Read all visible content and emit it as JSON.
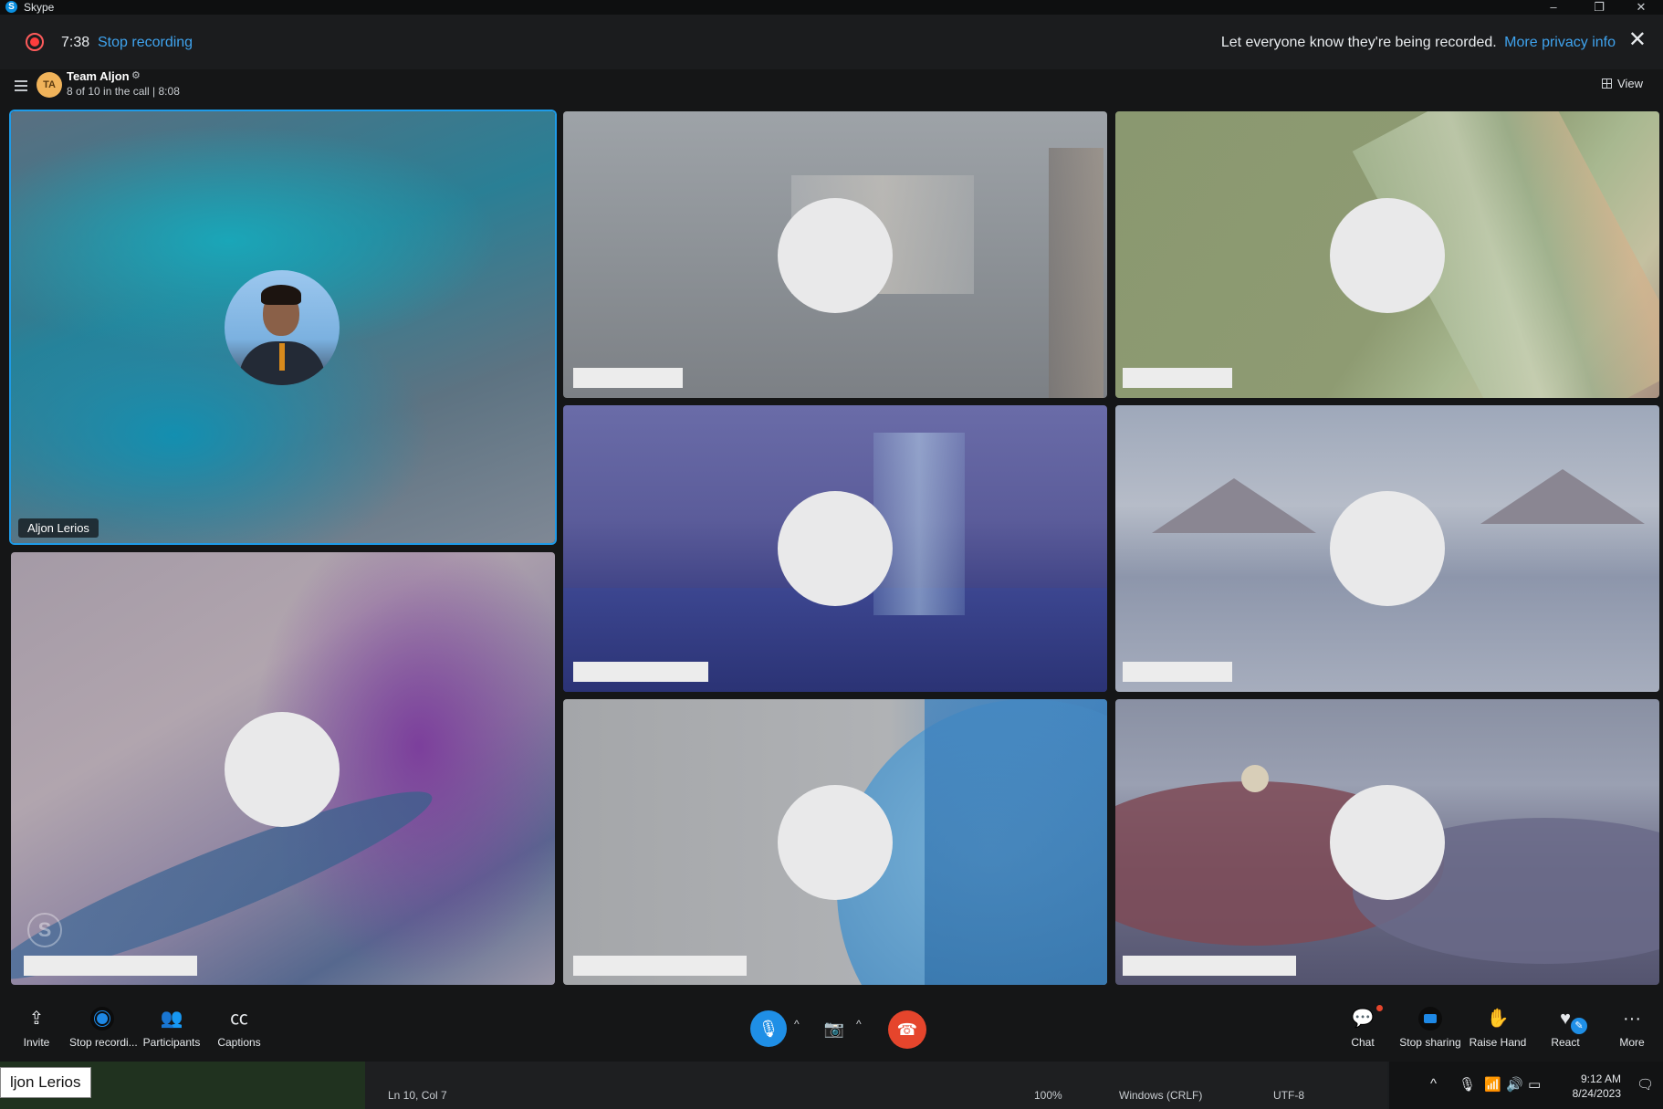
{
  "window": {
    "app_title": "Skype",
    "minimize": "–",
    "maximize": "❐",
    "close": "✕"
  },
  "recording": {
    "time": "7:38",
    "stop_label": "Stop recording",
    "notice": "Let everyone know they're being recorded.",
    "privacy_link": "More privacy info",
    "close": "✕"
  },
  "call": {
    "avatar_initials": "TA",
    "team_name": "Team Aljon",
    "settings_icon": "⚙",
    "participants_info": "8 of 10 in the call | 8:08",
    "view_label": "View"
  },
  "tiles": {
    "active_name": "Aljon Lerios",
    "watermark": "S"
  },
  "toolbar": {
    "invite": "Invite",
    "stop_recording": "Stop recordi...",
    "participants": "Participants",
    "captions": "Captions",
    "chat": "Chat",
    "stop_sharing": "Stop sharing",
    "raise_hand": "Raise Hand",
    "react": "React",
    "more": "More",
    "icons": {
      "invite": "⇪",
      "participants": "👥",
      "captions": "㏄",
      "mic": "🎙",
      "caret": "^",
      "camera_off": "📷",
      "hangup": "☎",
      "chat": "💬",
      "raise_hand": "✋",
      "react": "♥",
      "pen": "✎",
      "more": "···"
    }
  },
  "taskbar": {
    "tooltip": "ljon Lerios",
    "cursor_position": "Ln 10, Col 7",
    "zoom": "100%",
    "line_endings": "Windows (CRLF)",
    "encoding": "UTF-8",
    "time": "9:12 AM",
    "date": "8/24/2023",
    "tray_icons": {
      "chevron": "^",
      "mic": "🎙",
      "wifi": "📶",
      "volume": "🔊",
      "battery": "▭",
      "notifications": "🗨"
    }
  }
}
